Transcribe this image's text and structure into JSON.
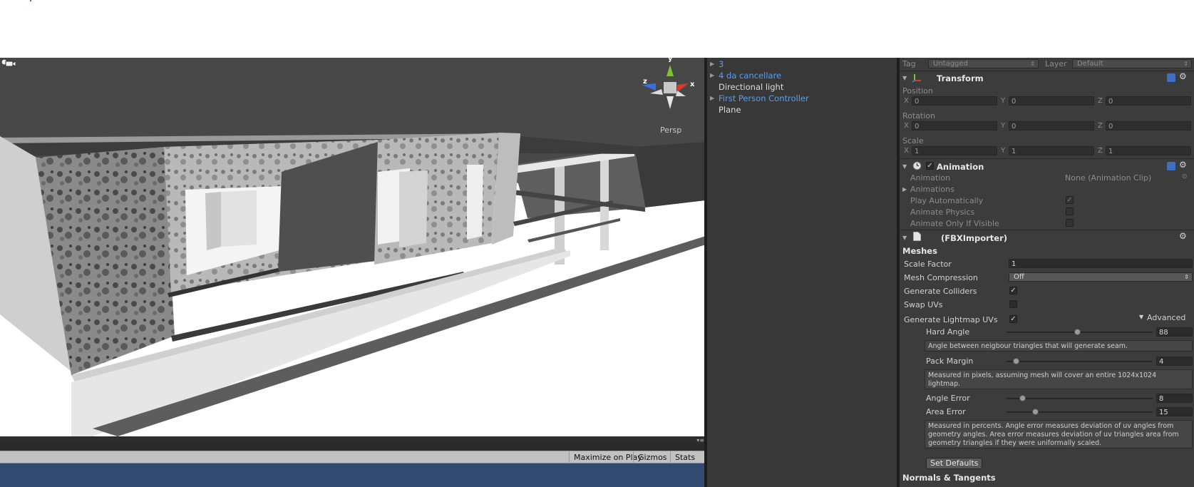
{
  "scene": {
    "projection_label": "Persp",
    "gizmo": {
      "y_label": "y",
      "x_label": "x",
      "z_label": "z"
    }
  },
  "game_toolbar": {
    "maximize_label": "Maximize on Play",
    "gizmos_label": "Gizmos",
    "stats_label": "Stats"
  },
  "hierarchy": {
    "items": [
      {
        "label": "3",
        "prefab": true,
        "expandable": true
      },
      {
        "label": "4 da cancellare",
        "prefab": true,
        "expandable": true
      },
      {
        "label": "Directional light",
        "prefab": false,
        "expandable": false
      },
      {
        "label": "First Person Controller",
        "prefab": true,
        "expandable": true
      },
      {
        "label": "Plane",
        "prefab": false,
        "expandable": false
      }
    ]
  },
  "inspector": {
    "tag_label": "Tag",
    "tag_value": "Untagged",
    "layer_label": "Layer",
    "layer_value": "Default",
    "transform": {
      "title": "Transform",
      "position_label": "Position",
      "rotation_label": "Rotation",
      "scale_label": "Scale",
      "axis_x": "X",
      "axis_y": "Y",
      "axis_z": "Z",
      "position": {
        "x": "0",
        "y": "0",
        "z": "0"
      },
      "rotation": {
        "x": "0",
        "y": "0",
        "z": "0"
      },
      "scale": {
        "x": "1",
        "y": "1",
        "z": "1"
      }
    },
    "animation": {
      "title": "Animation",
      "enabled": true,
      "animation_label": "Animation",
      "animation_value": "None (Animation Clip)",
      "animations_label": "Animations",
      "play_automatically_label": "Play Automatically",
      "play_automatically": true,
      "animate_physics_label": "Animate Physics",
      "animate_physics": false,
      "animate_only_if_visible_label": "Animate Only If Visible",
      "animate_only_if_visible": false
    },
    "importer": {
      "title": "(FBXImporter)",
      "meshes_header": "Meshes",
      "scale_factor_label": "Scale Factor",
      "scale_factor_value": "1",
      "mesh_compression_label": "Mesh Compression",
      "mesh_compression_value": "Off",
      "generate_colliders_label": "Generate Colliders",
      "generate_colliders": true,
      "swap_uvs_label": "Swap UVs",
      "swap_uvs": false,
      "generate_lightmap_uvs_label": "Generate Lightmap UVs",
      "generate_lightmap_uvs": true,
      "advanced_label": "Advanced",
      "hard_angle_label": "Hard Angle",
      "hard_angle_value": "88",
      "hard_angle_fraction": 0.49,
      "hard_angle_help": "Angle between neigbour triangles that will generate seam.",
      "pack_margin_label": "Pack Margin",
      "pack_margin_value": "4",
      "pack_margin_fraction": 0.07,
      "pack_margin_help": "Measured in pixels, assuming mesh will cover an entire 1024x1024 lightmap.",
      "angle_error_label": "Angle Error",
      "angle_error_value": "8",
      "angle_error_fraction": 0.11,
      "area_error_label": "Area Error",
      "area_error_value": "15",
      "area_error_fraction": 0.2,
      "error_help": "Measured in percents. Angle error measures deviation of uv angles from geometry angles. Area error measures deviation of uv triangles area from geometry triangles if they were uniformally scaled.",
      "set_defaults_label": "Set Defaults",
      "normals_header": "Normals & Tangents"
    }
  },
  "colors": {
    "prefab_blue": "#5b9cf0",
    "panel_dark": "#383838",
    "inspector_bg": "#3c3c3c",
    "game_view_blue": "#304a72"
  }
}
